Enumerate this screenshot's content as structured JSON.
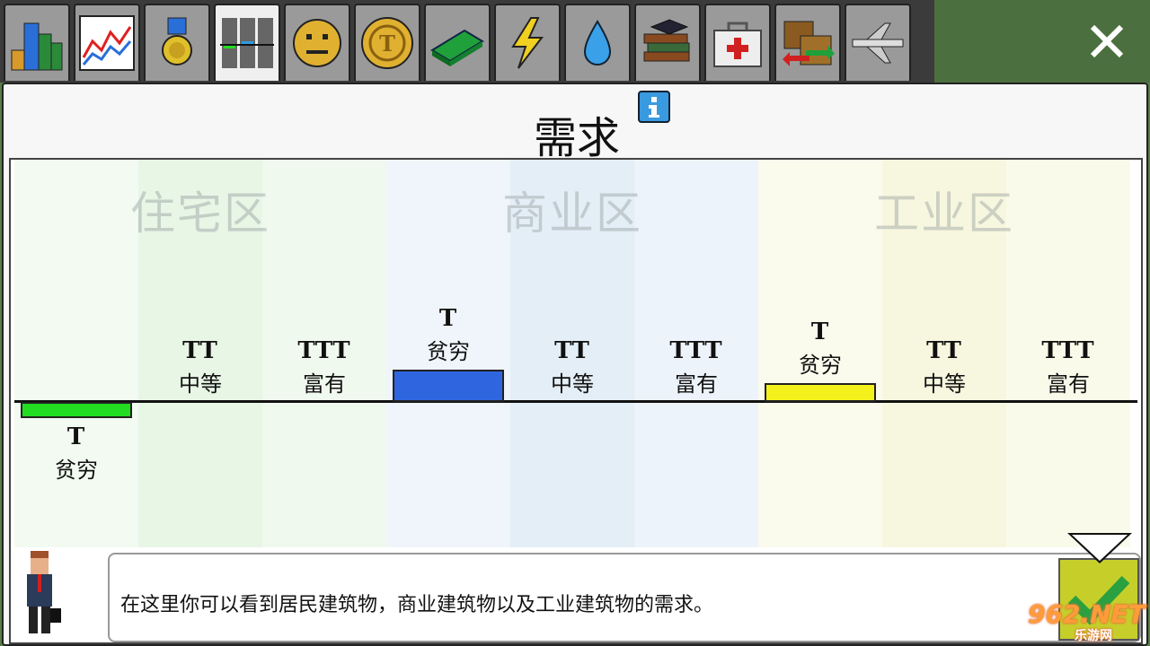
{
  "tabs": [
    {
      "name": "city-icon",
      "active": false
    },
    {
      "name": "graph-icon",
      "active": false
    },
    {
      "name": "medal-icon",
      "active": false
    },
    {
      "name": "demand-icon",
      "active": true
    },
    {
      "name": "smiley-icon",
      "active": false
    },
    {
      "name": "coin-icon",
      "active": false
    },
    {
      "name": "money-icon",
      "active": false
    },
    {
      "name": "lightning-icon",
      "active": false
    },
    {
      "name": "water-drop-icon",
      "active": false
    },
    {
      "name": "books-icon",
      "active": false
    },
    {
      "name": "medical-kit-icon",
      "active": false
    },
    {
      "name": "trade-icon",
      "active": false
    },
    {
      "name": "airplane-icon",
      "active": false
    }
  ],
  "panel": {
    "title": "需求",
    "info_icon": "info-icon"
  },
  "zones": [
    {
      "label": "住宅区",
      "color": "#b9e3b0"
    },
    {
      "label": "商业区",
      "color": "#a9c9e6"
    },
    {
      "label": "工业区",
      "color": "#e5e69a"
    }
  ],
  "demand_chart": {
    "levels": [
      {
        "zone": "住宅区",
        "tax": "T",
        "name": "贫穷",
        "demand": -0.3,
        "bar_color": "#22dd22"
      },
      {
        "zone": "住宅区",
        "tax": "TT",
        "name": "中等",
        "demand": 0,
        "bar_color": ""
      },
      {
        "zone": "住宅区",
        "tax": "TTT",
        "name": "富有",
        "demand": 0,
        "bar_color": ""
      },
      {
        "zone": "商业区",
        "tax": "T",
        "name": "贫穷",
        "demand": 0.6,
        "bar_color": "#2f66e0"
      },
      {
        "zone": "商业区",
        "tax": "TT",
        "name": "中等",
        "demand": 0,
        "bar_color": ""
      },
      {
        "zone": "商业区",
        "tax": "TTT",
        "name": "富有",
        "demand": 0,
        "bar_color": ""
      },
      {
        "zone": "工业区",
        "tax": "T",
        "name": "贫穷",
        "demand": 0.35,
        "bar_color": "#f4f01c"
      },
      {
        "zone": "工业区",
        "tax": "TT",
        "name": "中等",
        "demand": 0,
        "bar_color": ""
      },
      {
        "zone": "工业区",
        "tax": "TTT",
        "name": "富有",
        "demand": 0,
        "bar_color": ""
      }
    ]
  },
  "dialog": {
    "text": "在这里你可以看到居民建筑物，商业建筑物以及工业建筑物的需求。",
    "confirm_icon": "checkmark-icon"
  },
  "watermark": {
    "line1": "962.NET",
    "line2": "乐游网"
  }
}
